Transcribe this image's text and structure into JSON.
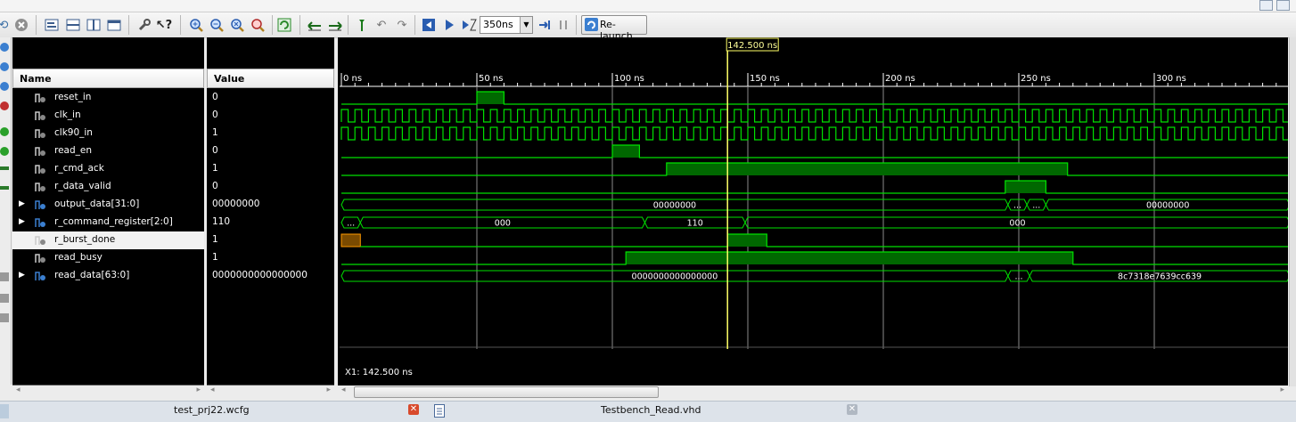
{
  "toolbar": {
    "time_value": "350ns",
    "relaunch_label": "Re-launch"
  },
  "names_panel": {
    "header": "Name"
  },
  "values_panel": {
    "header": "Value"
  },
  "signals": [
    {
      "name": "reset_in",
      "value": "0",
      "bus": false
    },
    {
      "name": "clk_in",
      "value": "0",
      "bus": false
    },
    {
      "name": "clk90_in",
      "value": "1",
      "bus": false
    },
    {
      "name": "read_en",
      "value": "0",
      "bus": false
    },
    {
      "name": "r_cmd_ack",
      "value": "1",
      "bus": false
    },
    {
      "name": "r_data_valid",
      "value": "0",
      "bus": false
    },
    {
      "name": "output_data[31:0]",
      "value": "00000000",
      "bus": true
    },
    {
      "name": "r_command_register[2:0]",
      "value": "110",
      "bus": true
    },
    {
      "name": "r_burst_done",
      "value": "1",
      "bus": false,
      "selected": true
    },
    {
      "name": "read_busy",
      "value": "1",
      "bus": false
    },
    {
      "name": "read_data[63:0]",
      "value": "0000000000000000",
      "bus": true
    }
  ],
  "waveform": {
    "cursor_label": "142.500 ns",
    "cursor_time": 142.5,
    "time_scale_ns": [
      0,
      350
    ],
    "ruler_labels": [
      "0 ns",
      "50 ns",
      "100 ns",
      "150 ns",
      "200 ns",
      "250 ns",
      "300 ns"
    ],
    "x1_readout": "X1: 142.500 ns",
    "output_data_values": [
      "00000000",
      "...",
      "...",
      "00000000"
    ],
    "command_values": [
      "...",
      "000",
      "110",
      "000"
    ],
    "read_data_values": [
      "0000000000000000",
      "...",
      "8c7318e7639cc639"
    ]
  },
  "tabs": [
    {
      "label": "test_prj22.wcfg"
    },
    {
      "label": "Testbench_Read.vhd"
    }
  ],
  "colors": {
    "wave_green": "#00e000",
    "high_fill": "#006800",
    "cursor": "#ffff66",
    "grid": "#8a8a8a"
  }
}
